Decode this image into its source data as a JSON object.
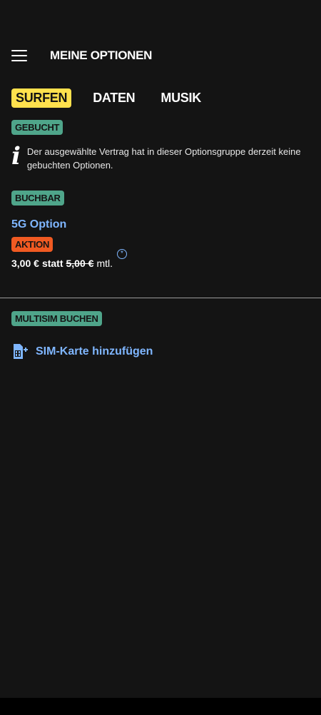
{
  "header": {
    "title": "MEINE OPTIONEN",
    "menu_icon": "hamburger-menu-icon"
  },
  "tabs": [
    {
      "label": "SURFEN",
      "active": true
    },
    {
      "label": "DATEN",
      "active": false
    },
    {
      "label": "MUSIK",
      "active": false
    }
  ],
  "booked": {
    "badge": "GEBUCHT",
    "info_icon": "info-icon",
    "info_text": "Der ausgewählte Vertrag hat in dieser Optionsgruppe derzeit keine gebuchten Optionen."
  },
  "bookable": {
    "badge": "BUCHBAR",
    "option_name": "5G Option",
    "promo_badge": "AKTION",
    "price_new": "3,00 €",
    "price_statt": "statt",
    "price_old": "5,00 €",
    "price_period": "mtl.",
    "footnote_symbol": "*"
  },
  "multisim": {
    "badge": "MULTISIM BUCHEN",
    "add_sim_label": "SIM-Karte hinzufügen",
    "add_sim_icon": "sim-card-add-icon"
  },
  "colors": {
    "background": "#141414",
    "active_tab": "#ffe14d",
    "badge_green": "#4fa58a",
    "badge_orange": "#f05a22",
    "link_blue": "#7fb6ff"
  }
}
